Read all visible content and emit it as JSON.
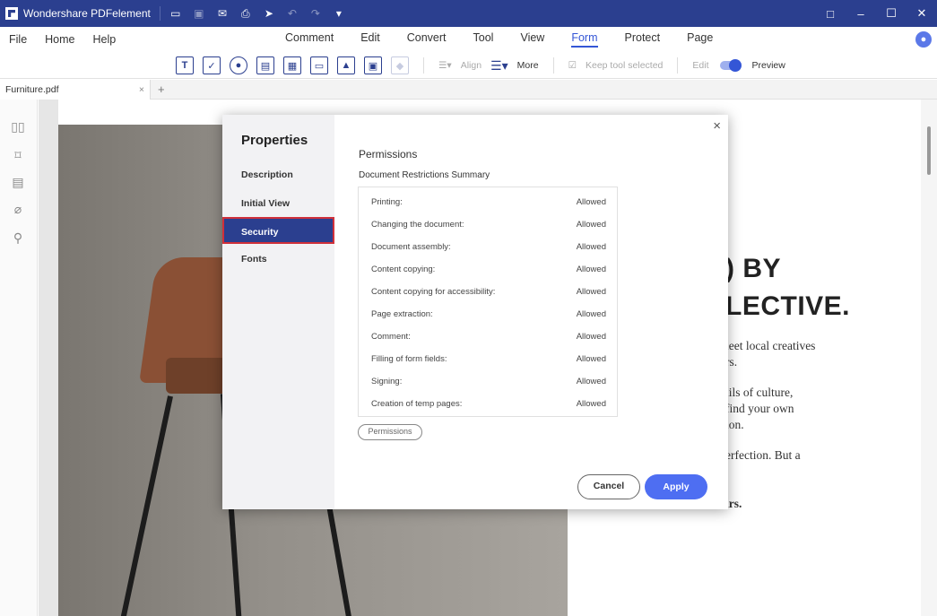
{
  "app": {
    "title": "Wondershare PDFelement",
    "quick_access_icons": [
      "folder-icon",
      "save-icon",
      "mail-icon",
      "print-icon",
      "cursor-icon",
      "undo-icon",
      "redo-icon",
      "dropdown-icon"
    ],
    "window_controls": [
      "□",
      "–",
      "☐",
      "✕"
    ]
  },
  "menu": {
    "left": [
      "File",
      "Home",
      "Help"
    ],
    "center": [
      "Comment",
      "Edit",
      "Convert",
      "Tool",
      "View",
      "Form",
      "Protect",
      "Page"
    ],
    "active": "Form",
    "user_initial": "👤"
  },
  "toolbar": {
    "align_label": "Align",
    "more_label": "More",
    "keep_tool_selected": "Keep tool selected",
    "edit_label": "Edit",
    "preview_label": "Preview"
  },
  "tabs": {
    "document": "Furniture.pdf",
    "close": "×",
    "new": "+"
  },
  "page": {
    "heading_line1": ") BY",
    "heading_line2": "LECTIVE.",
    "para1_line1": "ıeet local creatives",
    "para1_line2": "rs.",
    "para2_line1": "ıils of culture,",
    "para2_line2": "find your own",
    "para2_line3": "ion.",
    "para3_line1": "erfection. But a",
    "para4_line1": "ırs."
  },
  "dialog": {
    "title": "Properties",
    "nav": [
      "Description",
      "Initial View",
      "Security",
      "Fonts"
    ],
    "selected_nav": "Security",
    "section": "Permissions",
    "subsection": "Document Restrictions Summary",
    "permissions": [
      {
        "label": "Printing:",
        "value": "Allowed"
      },
      {
        "label": "Changing the document:",
        "value": "Allowed"
      },
      {
        "label": "Document assembly:",
        "value": "Allowed"
      },
      {
        "label": "Content copying:",
        "value": "Allowed"
      },
      {
        "label": "Content copying for accessibility:",
        "value": "Allowed"
      },
      {
        "label": "Page extraction:",
        "value": "Allowed"
      },
      {
        "label": "Comment:",
        "value": "Allowed"
      },
      {
        "label": "Filling of form fields:",
        "value": "Allowed"
      },
      {
        "label": "Signing:",
        "value": "Allowed"
      },
      {
        "label": "Creation of temp pages:",
        "value": "Allowed"
      }
    ],
    "permissions_button": "Permissions",
    "cancel_button": "Cancel",
    "apply_button": "Apply",
    "close": "×"
  },
  "colors": {
    "titlebar": "#2b3f8f",
    "accent": "#3456d6",
    "apply": "#4e6ef2",
    "selected_outline": "#d0303a"
  }
}
